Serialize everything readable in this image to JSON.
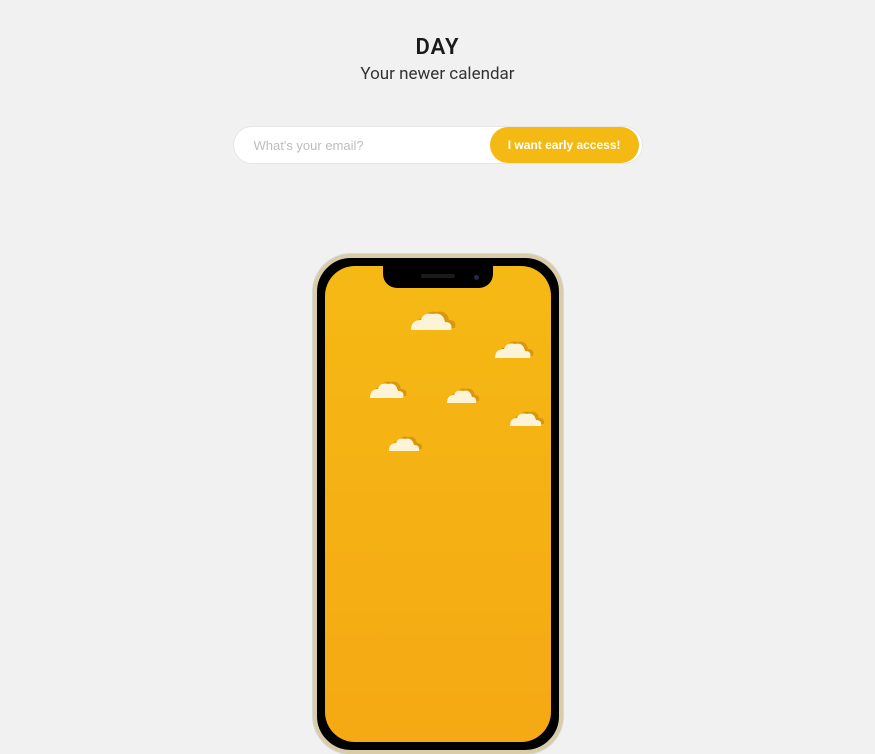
{
  "brand": {
    "name": "DAY",
    "tagline": "Your newer calendar"
  },
  "form": {
    "email_placeholder": "What's your email?",
    "cta_label": "I want early access!"
  },
  "colors": {
    "accent": "#f5b914",
    "background": "#f1f1f1"
  }
}
